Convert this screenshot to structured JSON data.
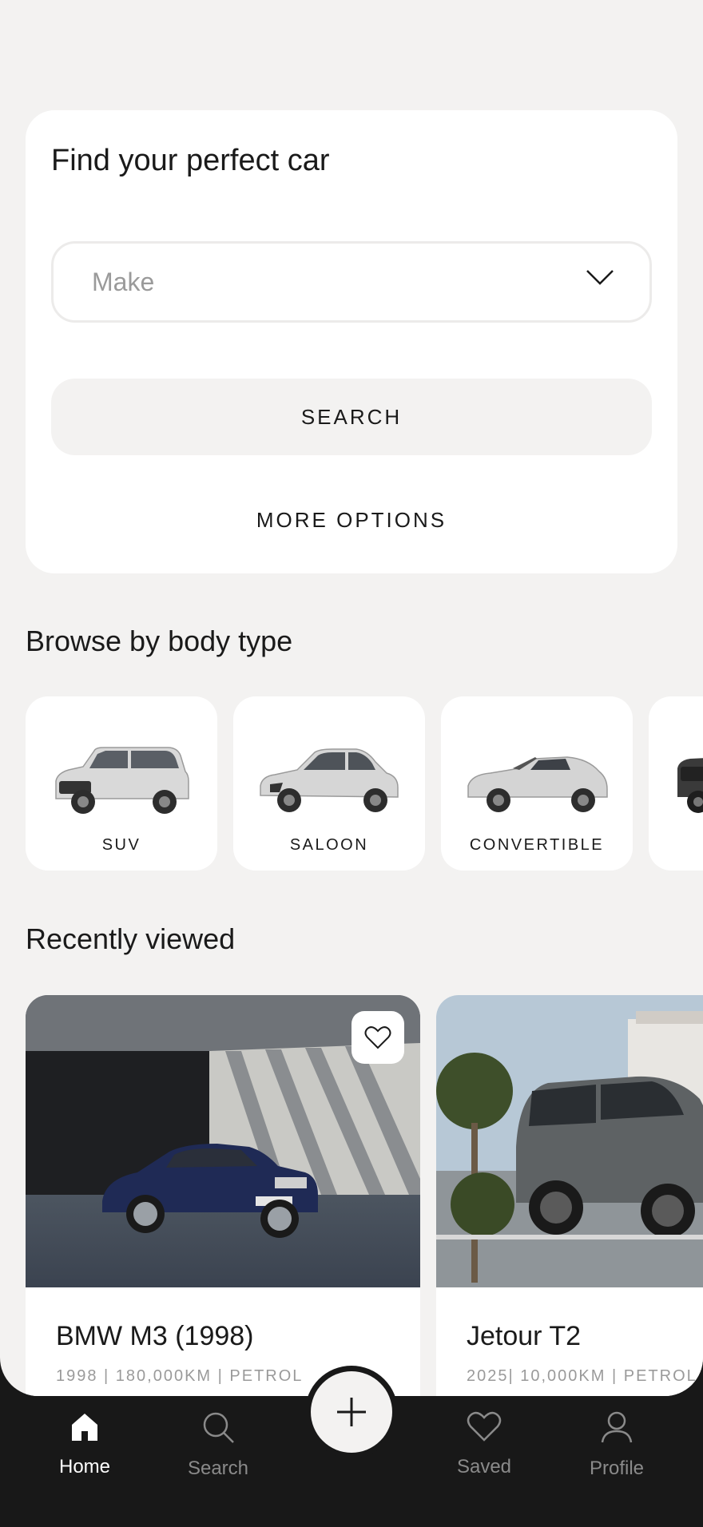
{
  "search": {
    "title": "Find your perfect car",
    "make_placeholder": "Make",
    "search_button": "SEARCH",
    "more_options": "MORE OPTIONS"
  },
  "body_types": {
    "title": "Browse by body type",
    "items": [
      {
        "label": "SUV",
        "icon": "suv-car-image"
      },
      {
        "label": "SALOON",
        "icon": "saloon-car-image"
      },
      {
        "label": "CONVERTIBLE",
        "icon": "convertible-car-image"
      },
      {
        "label": "",
        "icon": "pickup-car-image"
      }
    ]
  },
  "recent": {
    "title": "Recently viewed",
    "items": [
      {
        "name": "BMW M3 (1998)",
        "meta": "1998 | 180,000KM | PETROL",
        "photo": "bmw-m3-photo"
      },
      {
        "name": "Jetour T2",
        "meta": "2025| 10,000KM | PETROL",
        "photo": "jetour-t2-photo"
      }
    ]
  },
  "nav": {
    "home": "Home",
    "search": "Search",
    "saved": "Saved",
    "profile": "Profile",
    "add_icon": "plus-icon"
  },
  "colors": {
    "background": "#f3f2f1",
    "card": "#ffffff",
    "nav_bar": "#181818",
    "muted_text": "#9a9a9a"
  }
}
